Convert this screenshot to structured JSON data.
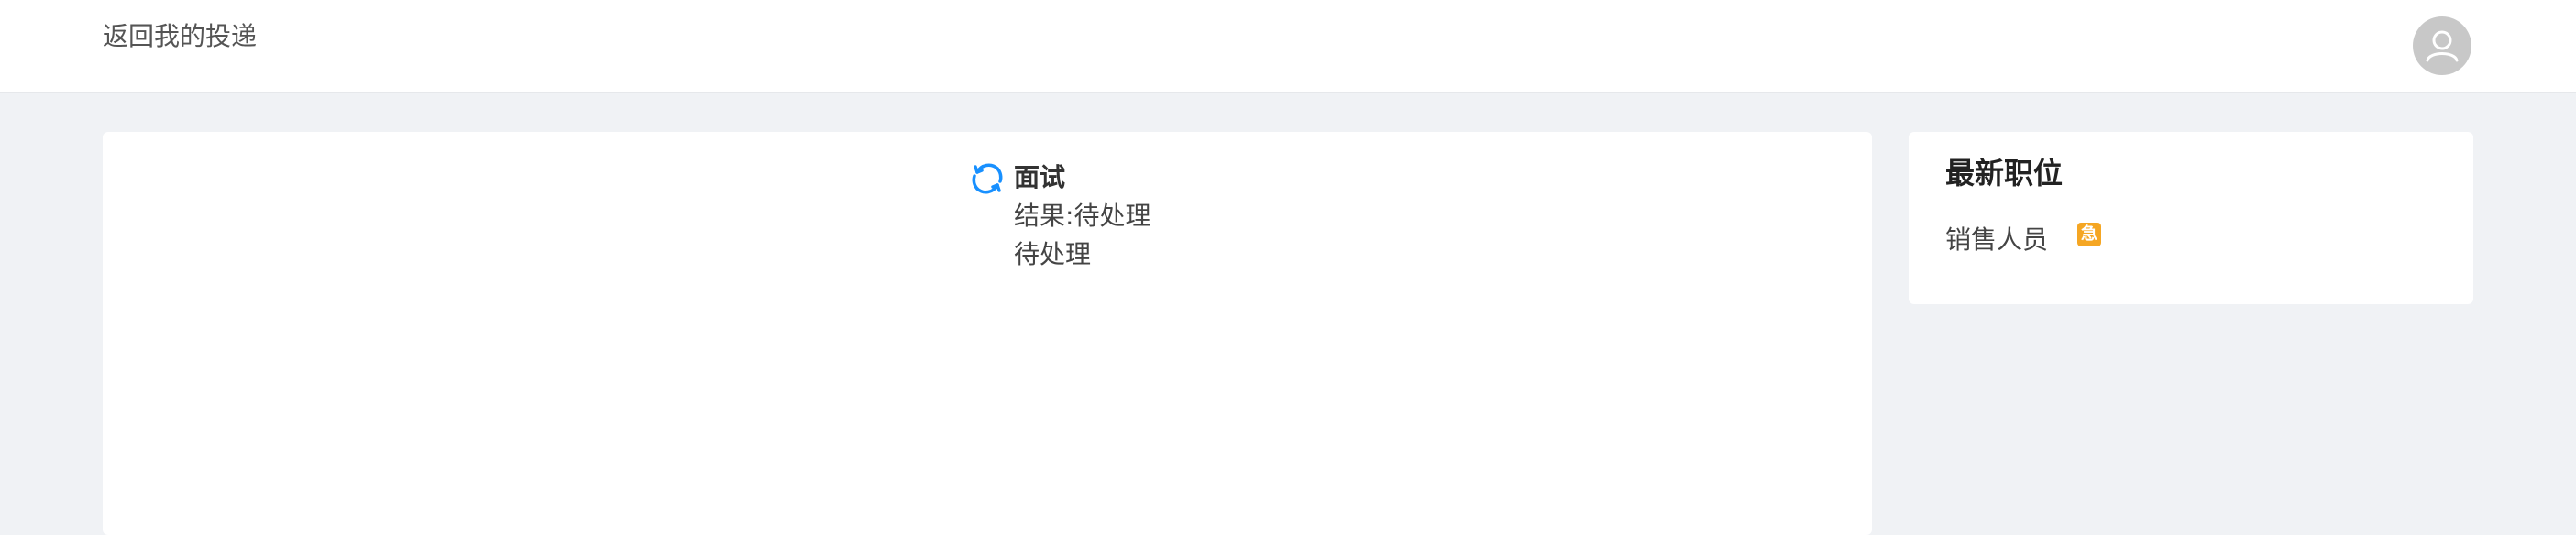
{
  "header": {
    "back_label": "返回我的投递",
    "avatar_icon": "user-avatar-icon"
  },
  "status": {
    "icon": "refresh-icon",
    "icon_color": "#1890ff",
    "title": "面试",
    "result_label": "结果",
    "result_separator": ":",
    "result_value": "待处理",
    "state": "待处理"
  },
  "sidebar": {
    "title": "最新职位",
    "jobs": [
      {
        "name": "销售人员",
        "badge": "急",
        "badge_color": "#f5a623"
      }
    ]
  }
}
